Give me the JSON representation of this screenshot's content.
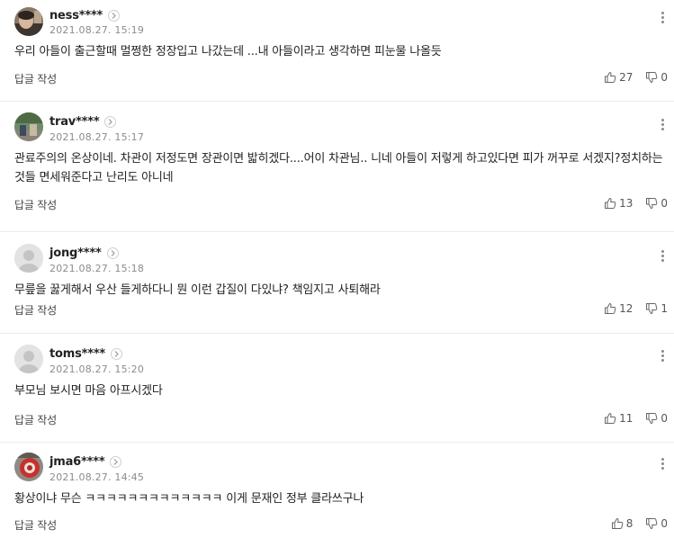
{
  "comments": [
    {
      "nickname": "ness****",
      "date": "2021.08.27. 15:19",
      "text": "우리 아들이 출근할때 멀쩡한 정장입고 나갔는데 ...내 아들이라고 생각하면 피눈물 나올듯",
      "reply_label": "답글 작성",
      "likes": "27",
      "dislikes": "0"
    },
    {
      "nickname": "trav****",
      "date": "2021.08.27. 15:17",
      "text": "관료주의의 온상이네. 차관이 저정도면 장관이면 밟히겠다....어이 차관님.. 니네 아들이 저렇게 하고있다면 피가 꺼꾸로 서겠지?정치하는 것들 면세워준다고 난리도 아니네",
      "reply_label": "답글 작성",
      "likes": "13",
      "dislikes": "0"
    },
    {
      "nickname": "jong****",
      "date": "2021.08.27. 15:18",
      "text": "무릎을 꿇게해서 우산 들게하다니 뭔 이런 갑질이 다있냐? 책임지고 사퇴해라",
      "reply_label": "답글 작성",
      "likes": "12",
      "dislikes": "1"
    },
    {
      "nickname": "toms****",
      "date": "2021.08.27. 15:20",
      "text": "부모님 보시면 마음 아프시겠다",
      "reply_label": "답글 작성",
      "likes": "11",
      "dislikes": "0"
    },
    {
      "nickname": "jma6****",
      "date": "2021.08.27. 14:45",
      "text": "황상이냐 무슨 ㅋㅋㅋㅋㅋㅋㅋㅋㅋㅋㅋㅋㅋ 이게 문재인 정부 클라쓰구나",
      "reply_label": "답글 작성",
      "likes": "8",
      "dislikes": "0"
    }
  ],
  "icons": {
    "profile_link": "chevron-right-circle-icon",
    "more": "vertical-ellipsis-icon",
    "like": "thumbs-up-icon",
    "dislike": "thumbs-down-icon"
  },
  "colors": {
    "text": "#222222",
    "meta": "#8c8c8c",
    "divider": "#ebebeb",
    "icon": "#666666"
  }
}
